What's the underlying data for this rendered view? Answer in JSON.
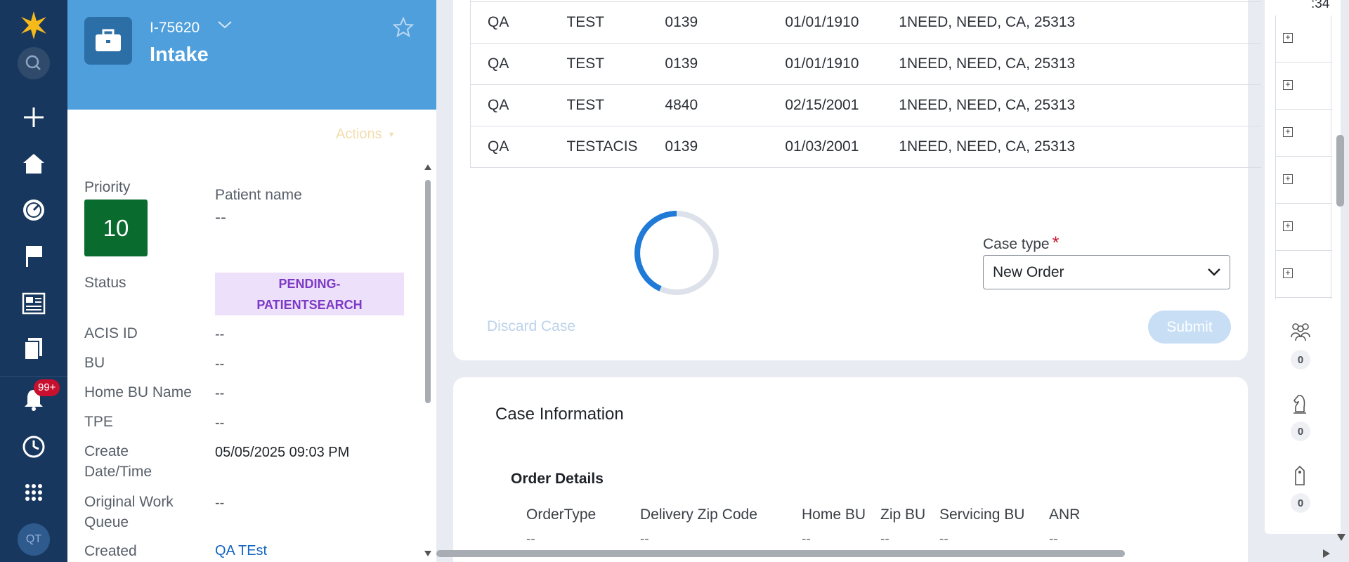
{
  "nav": {
    "notifications_badge": "99+",
    "avatar_initials": "QT",
    "icons": [
      "pega-logo-icon",
      "search-icon",
      "plus-icon",
      "home-icon",
      "dashboard-icon",
      "flag-icon",
      "news-icon",
      "documents-icon",
      "bell-icon",
      "history-icon",
      "apps-grid-icon"
    ]
  },
  "case": {
    "id": "I-75620",
    "title": "Intake",
    "actions_label": "Actions",
    "fields": {
      "priority_label": "Priority",
      "priority_value": "10",
      "patient_label": "Patient name",
      "patient_value": "--",
      "status_label": "Status",
      "status_value_line1": "PENDING-",
      "status_value_line2": "PATIENTSEARCH",
      "acis_label": "ACIS ID",
      "acis_value": "--",
      "bu_label": "BU",
      "bu_value": "--",
      "home_bu_label": "Home BU Name",
      "home_bu_value": "--",
      "tpe_label": "TPE",
      "tpe_value": "--",
      "create_label_line1": "Create",
      "create_label_line2": "Date/Time",
      "create_value": "05/05/2025 09:03 PM",
      "owq_label_line1": "Original Work",
      "owq_label_line2": "Queue",
      "owq_value": "--",
      "created_label": "Created",
      "created_value": "QA TEst"
    }
  },
  "results": {
    "rows": [
      [
        "QA",
        "TEST",
        "0139",
        "01/01/1910",
        "1NEED, NEED, CA, 25313"
      ],
      [
        "QA",
        "TEST",
        "0139",
        "01/01/1910",
        "1NEED, NEED, CA, 25313"
      ],
      [
        "QA",
        "TEST",
        "0139",
        "01/01/1910",
        "1NEED, NEED, CA, 25313"
      ],
      [
        "QA",
        "TEST",
        "4840",
        "02/15/2001",
        "1NEED, NEED, CA, 25313"
      ],
      [
        "QA",
        "TESTACIS",
        "0139",
        "01/03/2001",
        "1NEED, NEED, CA, 25313"
      ]
    ]
  },
  "form": {
    "case_type_label": "Case type",
    "required_mark": "*",
    "case_type_value": "New Order",
    "discard_label": "Discard Case",
    "submit_label": "Submit"
  },
  "case_info": {
    "title": "Case Information",
    "order_details_title": "Order Details",
    "headers": [
      "OrderType",
      "Delivery Zip Code",
      "Home BU",
      "Zip BU",
      "Servicing BU",
      "ANR"
    ],
    "values": [
      "--",
      "--",
      "--",
      "--",
      "--",
      "--"
    ]
  },
  "utility": {
    "corner_text": ":34",
    "plus_rows": 6,
    "counts": [
      {
        "icon": "team-icon",
        "value": "0"
      },
      {
        "icon": "chess-knight-icon",
        "value": "0"
      },
      {
        "icon": "tag-icon",
        "value": "0"
      }
    ]
  }
}
